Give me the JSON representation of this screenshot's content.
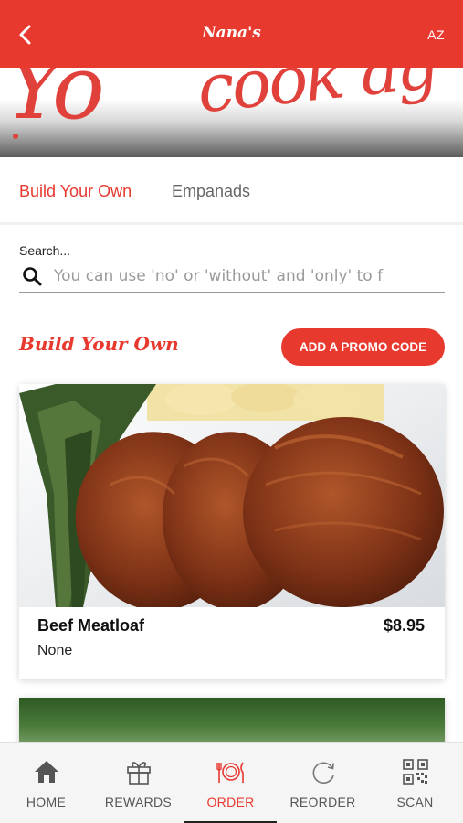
{
  "header": {
    "title": "Nana's",
    "language": "AZ"
  },
  "banner": {
    "script_left": "Yo",
    "script_right": "cook ag"
  },
  "tabs": [
    {
      "label": "Build Your Own",
      "active": true
    },
    {
      "label": "Empanads",
      "active": false
    }
  ],
  "search": {
    "label": "Search...",
    "placeholder": "You can use 'no' or 'without' and 'only' to f"
  },
  "section": {
    "title": "Build Your Own",
    "promo_button": "ADD A PROMO CODE"
  },
  "items": [
    {
      "name": "Beef Meatloaf",
      "price": "$8.95",
      "description": "None"
    }
  ],
  "bottom_nav": [
    {
      "label": "HOME",
      "icon": "home-icon"
    },
    {
      "label": "REWARDS",
      "icon": "gift-icon"
    },
    {
      "label": "ORDER",
      "icon": "plate-utensils-icon",
      "active": true
    },
    {
      "label": "REORDER",
      "icon": "refresh-icon"
    },
    {
      "label": "SCAN",
      "icon": "qr-code-icon"
    }
  ],
  "colors": {
    "accent": "#e8392f",
    "inactive": "#555555"
  }
}
